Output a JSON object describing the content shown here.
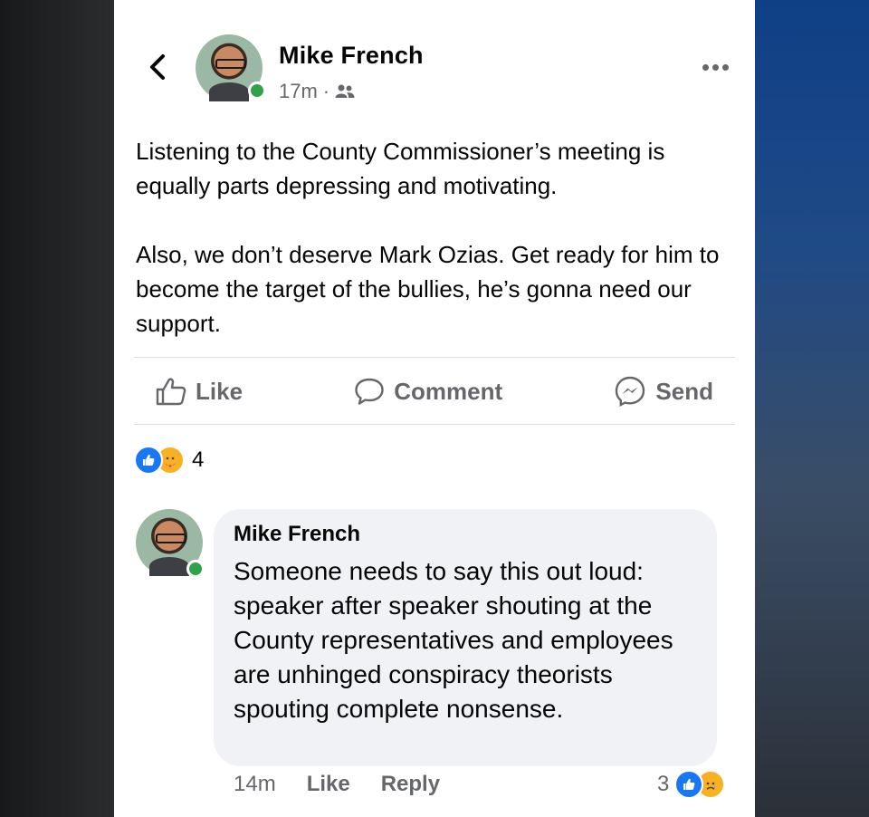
{
  "post": {
    "author": "Mike French",
    "time": "17m",
    "separator": "·",
    "audience_icon": "friends-icon",
    "paragraphs": [
      "Listening to the County Commissioner’s meeting is equally parts depressing and motivating.",
      "Also, we don’t deserve Mark Ozias. Get ready for him to become the target of the bullies, he’s gonna need our support."
    ],
    "actions": {
      "like_label": "Like",
      "comment_label": "Comment",
      "send_label": "Send"
    },
    "reactions": {
      "types": [
        "like",
        "care"
      ],
      "count": "4"
    }
  },
  "comment": {
    "author": "Mike French",
    "text": "Someone needs to say this out loud: speaker after speaker shouting at the County representatives and employees are unhinged conspiracy theorists spouting complete nonsense.",
    "time": "14m",
    "like_label": "Like",
    "reply_label": "Reply",
    "reactions": {
      "types": [
        "like",
        "sad"
      ],
      "count": "3"
    }
  },
  "colors": {
    "accent": "#1877f2",
    "online": "#31a24c",
    "secondary_text": "#65676b",
    "bubble": "#f0f2f5"
  }
}
